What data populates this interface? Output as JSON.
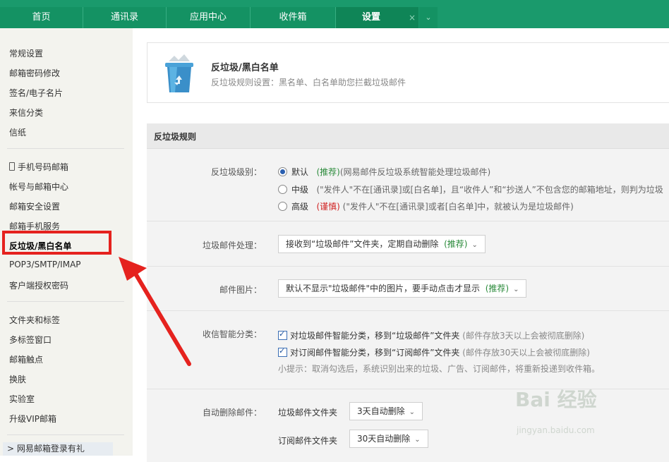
{
  "nav": {
    "tabs": [
      "首页",
      "通讯录",
      "应用中心",
      "收件箱",
      "设置"
    ],
    "close_glyph": "×",
    "more_glyph": "⌄"
  },
  "sidebar": {
    "group1": [
      "常规设置",
      "邮箱密码修改",
      "签名/电子名片",
      "来信分类",
      "信纸"
    ],
    "group2": [
      "手机号码邮箱",
      "帐号与邮箱中心",
      "邮箱安全设置",
      "邮箱手机服务",
      "反垃圾/黑白名单",
      "POP3/SMTP/IMAP",
      "客户端授权密码"
    ],
    "group3": [
      "文件夹和标签",
      "多标签窗口",
      "邮箱触点",
      "换肤",
      "实验室",
      "升级VIP邮箱"
    ],
    "footer": "> 网易邮箱登录有礼"
  },
  "header": {
    "title": "反垃圾/黑白名单",
    "subtitle": "反垃圾规则设置：黑名单、白名单助您拦截垃圾邮件"
  },
  "section": {
    "title": "反垃圾规则",
    "level": {
      "label": "反垃圾级别：",
      "options": [
        {
          "name": "默认",
          "tag": "(推荐)",
          "desc": "(网易邮件反垃圾系统智能处理垃圾邮件)"
        },
        {
          "name": "中级",
          "tag": "",
          "desc": "(\"发件人\"不在[通讯录]或[白名单]，且“收件人”和“抄送人”不包含您的邮箱地址，则判为垃圾"
        },
        {
          "name": "高级",
          "tag": "(谨慎)",
          "desc": "(\"发件人\"不在[通讯录]或者[白名单]中，就被认为是垃圾邮件)"
        }
      ]
    },
    "handling": {
      "label": "垃圾邮件处理：",
      "value": "接收到“垃圾邮件”文件夹，定期自动删除",
      "tag": "(推荐)"
    },
    "images": {
      "label": "邮件图片：",
      "value": "默认不显示\"垃圾邮件\"中的图片，要手动点击才显示",
      "tag": "(推荐)"
    },
    "smart": {
      "label": "收信智能分类：",
      "items": [
        {
          "text": "对垃圾邮件智能分类，移到“垃圾邮件”文件夹",
          "note": "(邮件存放3天以上会被彻底删除)"
        },
        {
          "text": "对订阅邮件智能分类，移到“订阅邮件”文件夹",
          "note": "(邮件存放30天以上会被彻底删除)"
        }
      ],
      "hint": "小提示：取消勾选后，系统识别出来的垃圾、广告、订阅邮件，将重新投递到收件箱。"
    },
    "autodelete": {
      "label": "自动删除邮件：",
      "rows": [
        {
          "folder": "垃圾邮件文件夹",
          "value": "3天自动删除"
        },
        {
          "folder": "订阅邮件文件夹",
          "value": "30天自动删除"
        }
      ]
    }
  },
  "watermark": {
    "main": "Bai 经验",
    "sub": "jingyan.baidu.com"
  },
  "colors": {
    "nav_green": "#1a9a6c",
    "highlight_red": "#e5221e",
    "recommend_green": "#2a8a3a"
  }
}
